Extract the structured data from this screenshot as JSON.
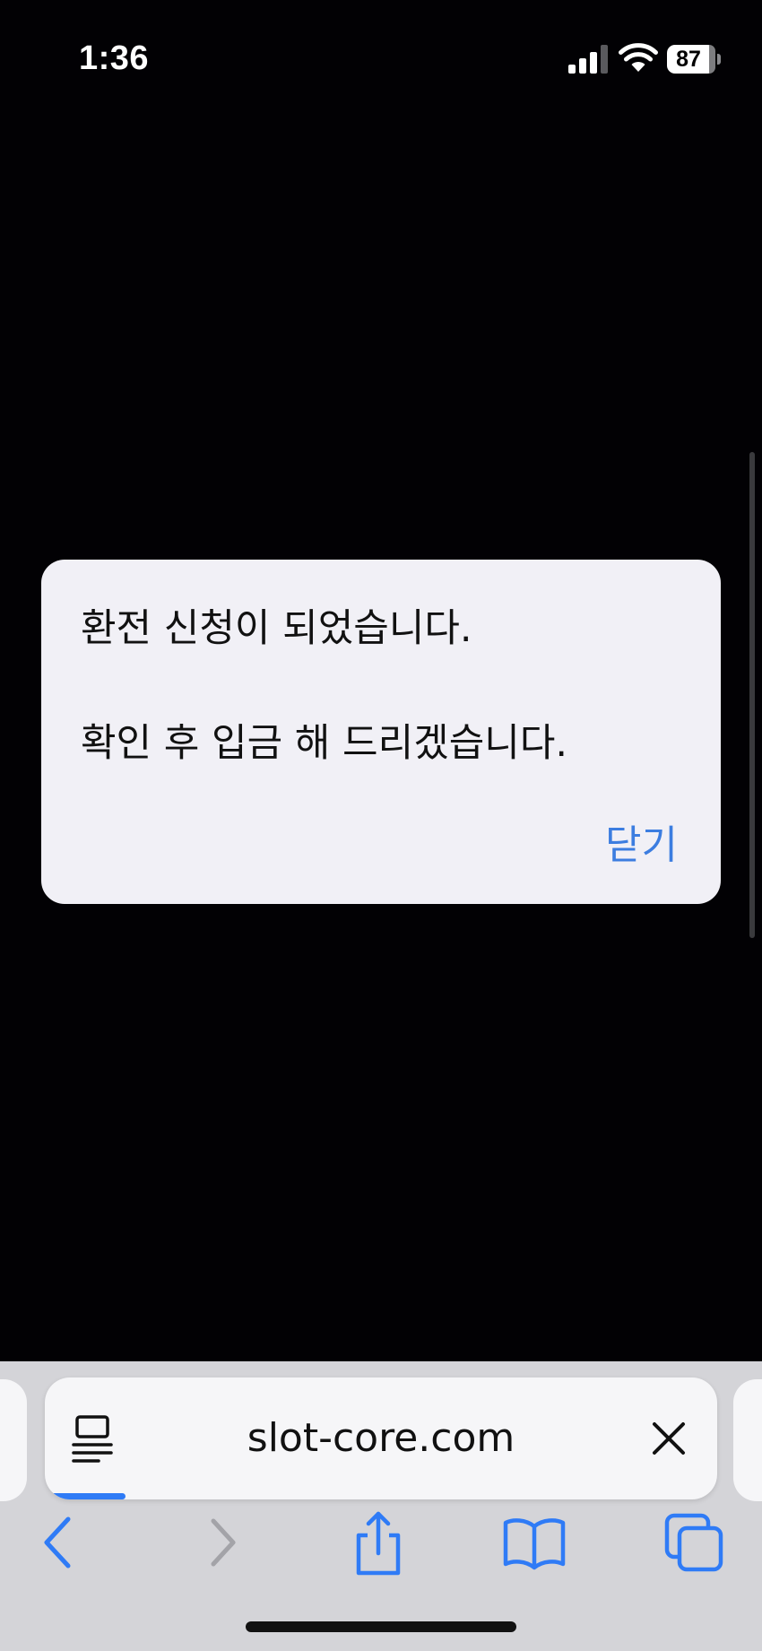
{
  "status_bar": {
    "time": "1:36",
    "battery_percent": "87",
    "battery_level": 0.87,
    "signal_bars_active": 3,
    "icons": [
      "signal-icon",
      "wifi-icon",
      "battery-icon"
    ]
  },
  "alert": {
    "line_1": "환전 신청이 되었습니다.",
    "line_2": "확인 후 입금 해 드리겠습니다.",
    "close_label": "닫기"
  },
  "address_bar": {
    "url": "slot-core.com",
    "load_progress": 0.12,
    "icons": [
      "reader-icon",
      "clear-icon"
    ]
  },
  "toolbar": {
    "icons": [
      "back-icon",
      "forward-icon",
      "share-icon",
      "bookmarks-icon",
      "tabs-icon"
    ]
  },
  "colors": {
    "accent": "#3c7de0",
    "dialog_background": "#f1f0f6",
    "page_background": "#020104",
    "toolbar_background": "#d4d4d8"
  }
}
